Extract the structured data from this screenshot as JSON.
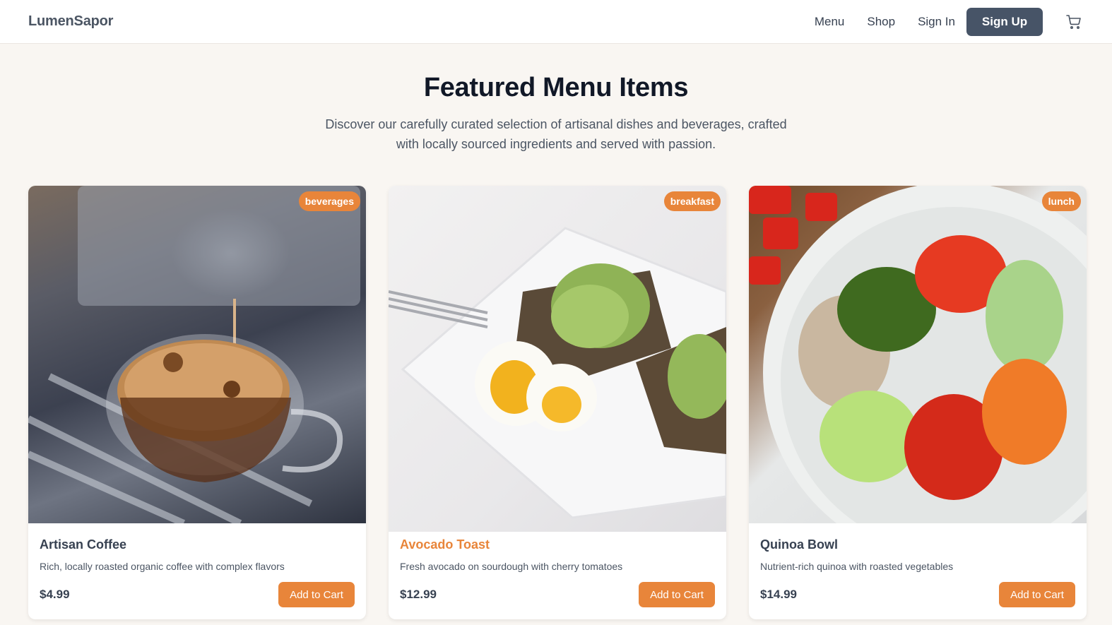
{
  "nav": {
    "brand": "LumenSapor",
    "links": [
      {
        "label": "Menu"
      },
      {
        "label": "Shop"
      },
      {
        "label": "Sign In"
      }
    ],
    "signup_label": "Sign Up",
    "cart_icon": "cart-icon"
  },
  "hero": {
    "title": "Featured Menu Items",
    "subtitle": "Discover our carefully curated selection of artisanal dishes and beverages, crafted with locally sourced ingredients and served with passion."
  },
  "colors": {
    "accent": "#e8853a",
    "primary_button": "#475467",
    "background": "#f9f6f2"
  },
  "items": [
    {
      "category": "beverages",
      "name": "Artisan Coffee",
      "description": "Rich, locally roasted organic coffee with complex flavors",
      "price": "$4.99",
      "button_label": "Add to Cart",
      "image": "espresso cup under coffee machine"
    },
    {
      "category": "breakfast",
      "name": "Avocado Toast",
      "description": "Fresh avocado on sourdough with cherry tomatoes",
      "price": "$12.99",
      "button_label": "Add to Cart",
      "image": "avocado toast with soft-boiled egg on white plate"
    },
    {
      "category": "lunch",
      "name": "Quinoa Bowl",
      "description": "Nutrient-rich quinoa with roasted vegetables",
      "price": "$14.99",
      "button_label": "Add to Cart",
      "image": "quinoa bowl with broccoli, peppers, cucumber, carrots and tomatoes"
    }
  ]
}
